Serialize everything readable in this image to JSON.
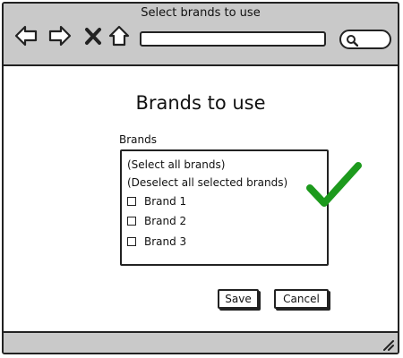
{
  "window": {
    "title": "Select brands to use"
  },
  "toolbar": {
    "icons": [
      "back-arrow-icon",
      "forward-arrow-icon",
      "close-x-icon",
      "home-icon",
      "search-icon"
    ],
    "address_value": ""
  },
  "page": {
    "title": "Brands to use"
  },
  "brands_field": {
    "label": "Brands",
    "select_all": "(Select all brands)",
    "deselect_all": "(Deselect all selected brands)",
    "items": [
      {
        "label": "Brand 1",
        "checked": false
      },
      {
        "label": "Brand 2",
        "checked": false
      },
      {
        "label": "Brand 3",
        "checked": false
      }
    ]
  },
  "actions": {
    "save_label": "Save",
    "cancel_label": "Cancel"
  },
  "colors": {
    "chrome": "#c9c9c9",
    "outline": "#222222",
    "check": "#1d9a1d"
  }
}
